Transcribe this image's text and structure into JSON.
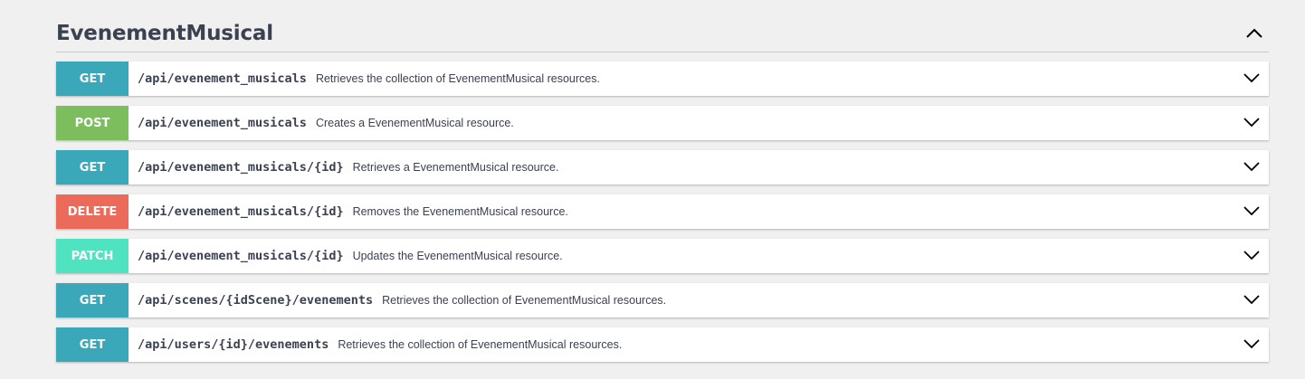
{
  "section": {
    "title": "EvenementMusical",
    "toggle_icon": "chevron-up-icon"
  },
  "colors": {
    "GET": "#3aa8b8",
    "POST": "#7cbd5e",
    "DELETE": "#ec6a5a",
    "PATCH": "#50e3c2"
  },
  "operations": [
    {
      "method": "GET",
      "path": "/api/evenement_musicals",
      "summary": "Retrieves the collection of EvenementMusical resources."
    },
    {
      "method": "POST",
      "path": "/api/evenement_musicals",
      "summary": "Creates a EvenementMusical resource."
    },
    {
      "method": "GET",
      "path": "/api/evenement_musicals/{id}",
      "summary": "Retrieves a EvenementMusical resource."
    },
    {
      "method": "DELETE",
      "path": "/api/evenement_musicals/{id}",
      "summary": "Removes the EvenementMusical resource."
    },
    {
      "method": "PATCH",
      "path": "/api/evenement_musicals/{id}",
      "summary": "Updates the EvenementMusical resource."
    },
    {
      "method": "GET",
      "path": "/api/scenes/{idScene}/evenements",
      "summary": "Retrieves the collection of EvenementMusical resources."
    },
    {
      "method": "GET",
      "path": "/api/users/{id}/evenements",
      "summary": "Retrieves the collection of EvenementMusical resources."
    }
  ]
}
